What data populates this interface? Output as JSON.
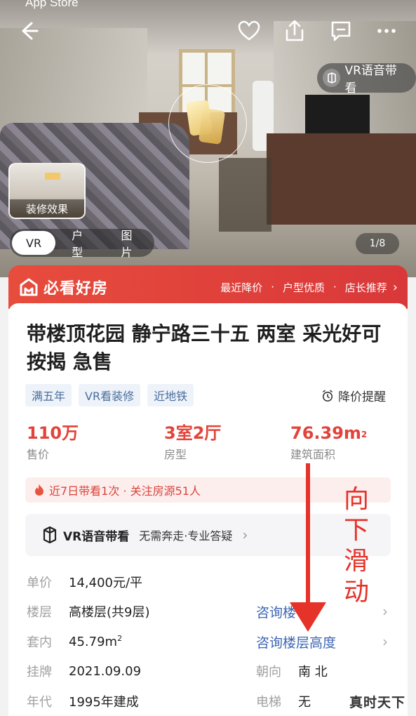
{
  "status_bar": {
    "back_app": "App Store"
  },
  "hero": {
    "vr_voice_pill": "VR语音带看",
    "thumbnail_label": "装修效果",
    "media_tabs": [
      "VR",
      "户型",
      "图片"
    ],
    "page_indicator": "1/8"
  },
  "banner": {
    "brand": "必看好房",
    "perks": [
      "最近降价",
      "户型优质",
      "店长推荐"
    ]
  },
  "listing": {
    "title": "带楼顶花园 静宁路三十五 两室 采光好可按揭 急售",
    "tags": [
      "满五年",
      "VR看装修",
      "近地铁"
    ],
    "price_alert": "降价提醒",
    "stats": [
      {
        "value": "110万",
        "label": "售价"
      },
      {
        "value": "3室2厅",
        "label": "房型"
      },
      {
        "value": "76.39m",
        "sup": "2",
        "label": "建筑面积"
      }
    ],
    "hot_text": "近7日带看1次 · 关注房源51人",
    "vr_box": {
      "name": "VR语音带看",
      "desc": "无需奔走·专业答疑"
    },
    "details": {
      "unit_price": {
        "key": "单价",
        "value": "14,400元/平"
      },
      "floor": {
        "key": "楼层",
        "value": "高楼层(共9层)",
        "link": "咨询楼"
      },
      "inner_area": {
        "key": "套内",
        "value": "45.79m",
        "sup": "2",
        "link": "咨询楼层高度"
      },
      "listed": {
        "key": "挂牌",
        "value": "2021.09.09"
      },
      "orientation": {
        "key": "朝向",
        "value": "南 北"
      },
      "year": {
        "key": "年代",
        "value": "1995年建成"
      },
      "elevator": {
        "key": "电梯",
        "value": "无"
      }
    }
  },
  "annotation": {
    "text": [
      "向",
      "下",
      "滑",
      "动"
    ],
    "color": "#e5332a"
  },
  "watermark": "真时天下",
  "colors": {
    "accent_red": "#e2433a",
    "banner_red": "#e74c3c",
    "link_blue": "#3d66b3",
    "tag_blue": "#4a6e9c"
  }
}
